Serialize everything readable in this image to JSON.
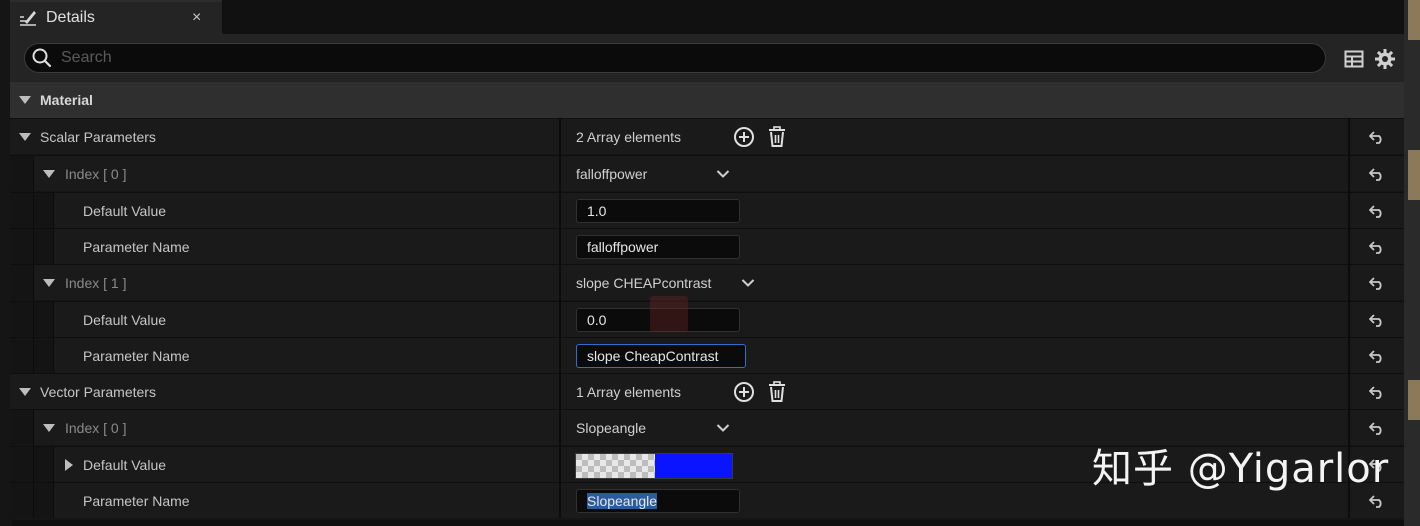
{
  "tab": {
    "title": "Details",
    "close": "×"
  },
  "search": {
    "placeholder": "Search"
  },
  "category": {
    "title": "Material"
  },
  "scalar": {
    "label": "Scalar Parameters",
    "count": "2 Array elements",
    "items": [
      {
        "index_label": "Index [ 0 ]",
        "selected": "falloffpower",
        "default_label": "Default Value",
        "default_value": "1.0",
        "name_label": "Parameter Name",
        "name_value": "falloffpower"
      },
      {
        "index_label": "Index [ 1 ]",
        "selected": "slope CHEAPcontrast",
        "default_label": "Default Value",
        "default_value": "0.0",
        "name_label": "Parameter Name",
        "name_value": "slope CheapContrast"
      }
    ]
  },
  "vector": {
    "label": "Vector Parameters",
    "count": "1 Array elements",
    "items": [
      {
        "index_label": "Index [ 0 ]",
        "selected": "Slopeangle",
        "default_label": "Default Value",
        "color": "#0a14ff",
        "name_label": "Parameter Name",
        "name_value": "Slopeangle"
      }
    ]
  },
  "watermark": "知乎 @Yigarlor",
  "colors": {
    "accent": "#2f6dd0",
    "panel": "#1a1a1a",
    "header": "#2f2f2f"
  }
}
